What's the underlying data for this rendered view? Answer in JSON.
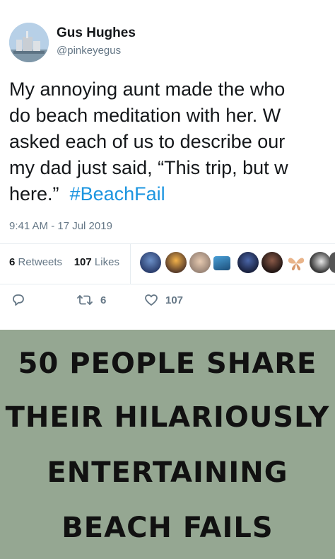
{
  "tweet": {
    "author_name": "Gus Hughes",
    "author_handle": "@pinkeyegus",
    "body_lines": [
      "My annoying aunt made the who",
      "do beach meditation with her. W",
      "asked each of us to describe our",
      "my dad just said, “This trip, but w"
    ],
    "last_line_text": "here.”",
    "hashtag": "#BeachFail",
    "timestamp": "9:41 AM - 17 Jul 2019",
    "retweets_count": "6",
    "retweets_label": "Retweets",
    "likes_count": "107",
    "likes_label": "Likes",
    "reply_icon": "reply-icon",
    "retweet_icon": "retweet-icon",
    "retweet_action_count": "6",
    "like_icon": "heart-icon",
    "like_action_count": "107",
    "hashtag_color": "#1b95e0"
  },
  "banner": {
    "lines": [
      "50 PEOPLE SHARE",
      "THEIR HILARIOUSLY",
      "ENTERTAINING",
      "BEACH FAILS"
    ],
    "background_color": "#95a792"
  }
}
